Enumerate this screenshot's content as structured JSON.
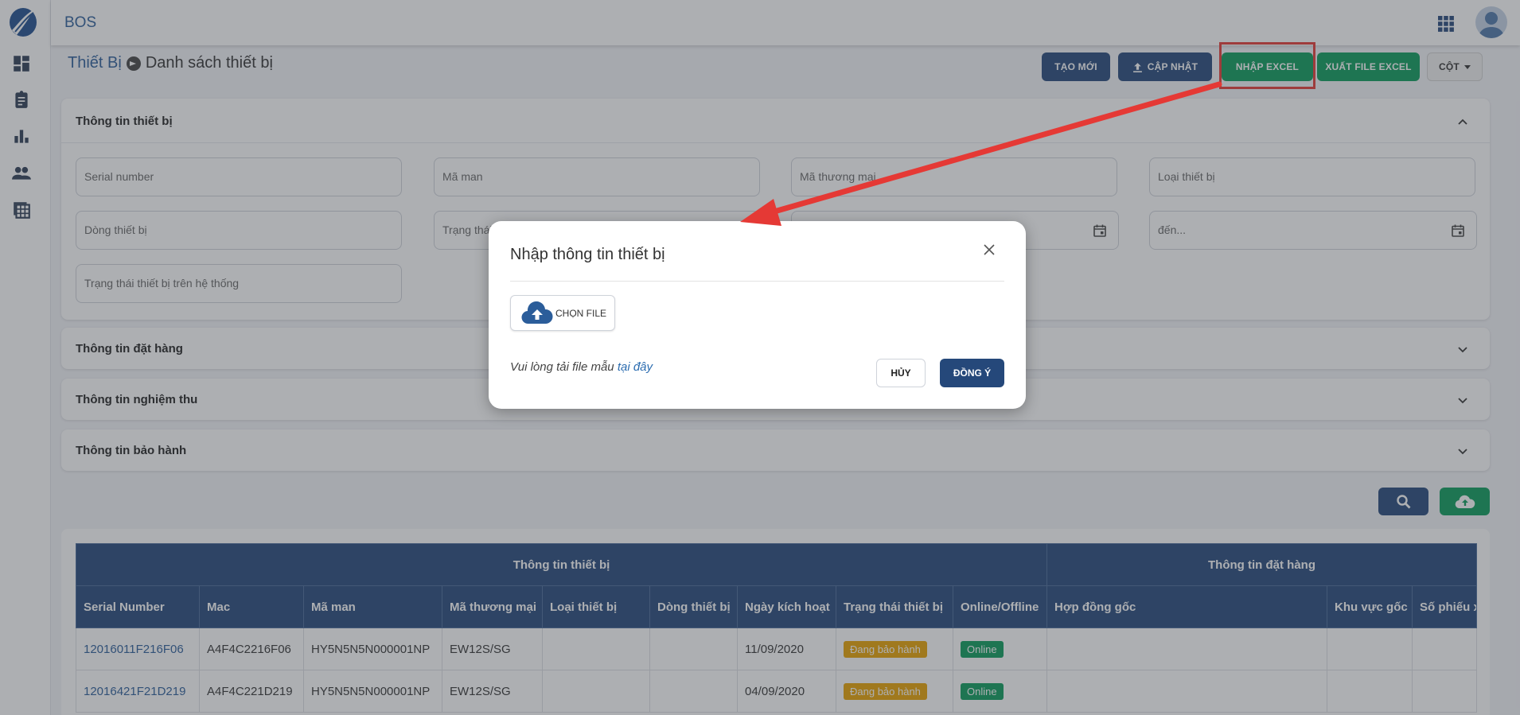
{
  "app": {
    "name": "BOS"
  },
  "sidebar": {
    "items": [
      {
        "icon": "dashboard-icon"
      },
      {
        "icon": "clipboard-icon"
      },
      {
        "icon": "bar-chart-icon"
      },
      {
        "icon": "people-icon"
      },
      {
        "icon": "table-icon"
      }
    ]
  },
  "breadcrumb": {
    "parent": "Thiết Bị",
    "current": "Danh sách thiết bị"
  },
  "toolbar": {
    "create_label": "TẠO MỚI",
    "update_label": "CẬP NHẬT",
    "import_label": "NHẬP EXCEL",
    "export_label": "XUẤT FILE EXCEL",
    "columns_label": "CỘT"
  },
  "sections": {
    "device_info": "Thông tin thiết bị",
    "order_info": "Thông tin đặt hàng",
    "acceptance_info": "Thông tin nghiệm thu",
    "warranty_info": "Thông tin bảo hành"
  },
  "filters": {
    "serial": "Serial number",
    "ma_man": "Mã man",
    "ma_thuong_mai": "Mã thương mại",
    "loai_thiet_bi": "Loại thiết bị",
    "dong_thiet_bi": "Dòng thiết bị",
    "trang_thai": "Trạng thái",
    "den": "đến...",
    "trang_thai_he_thong": "Trạng thái thiết bị trên hệ thống"
  },
  "table": {
    "groups": [
      "Thông tin thiết bị",
      "Thông tin đặt hàng"
    ],
    "columns": [
      "Serial Number",
      "Mac",
      "Mã man",
      "Mã thương mại",
      "Loại thiết bị",
      "Dòng thiết bị",
      "Ngày kích hoạt",
      "Trạng thái thiết bị",
      "Online/Offline",
      "Hợp đồng gốc",
      "Khu vực gốc",
      "Số phiếu x"
    ],
    "rows": [
      {
        "serial": "12016011F216F06",
        "mac": "A4F4C2216F06",
        "ma_man": "HY5N5N5N000001NP",
        "ma_thuong_mai": "EW12S/SG",
        "loai": "",
        "dong": "",
        "ngay": "11/09/2020",
        "trang_thai": "Đang bảo hành",
        "online": "Online",
        "hop_dong": "",
        "khu_vuc": "",
        "so_phieu": ""
      },
      {
        "serial": "12016421F21D219",
        "mac": "A4F4C221D219",
        "ma_man": "HY5N5N5N000001NP",
        "ma_thuong_mai": "EW12S/SG",
        "loai": "",
        "dong": "",
        "ngay": "04/09/2020",
        "trang_thai": "Đang bảo hành",
        "online": "Online",
        "hop_dong": "",
        "khu_vuc": "",
        "so_phieu": ""
      }
    ]
  },
  "modal": {
    "title": "Nhập thông tin thiết bị",
    "choose_file_label": "CHỌN FILE",
    "template_note": "Vui lòng tải file mẫu",
    "template_link": "tại đây",
    "cancel_label": "HỦY",
    "confirm_label": "ĐỒNG Ý"
  },
  "colors": {
    "navy": "#25487a",
    "green": "#0a9b5a",
    "annotation_red": "#e53935",
    "warranty_tag": "#e8a200"
  }
}
